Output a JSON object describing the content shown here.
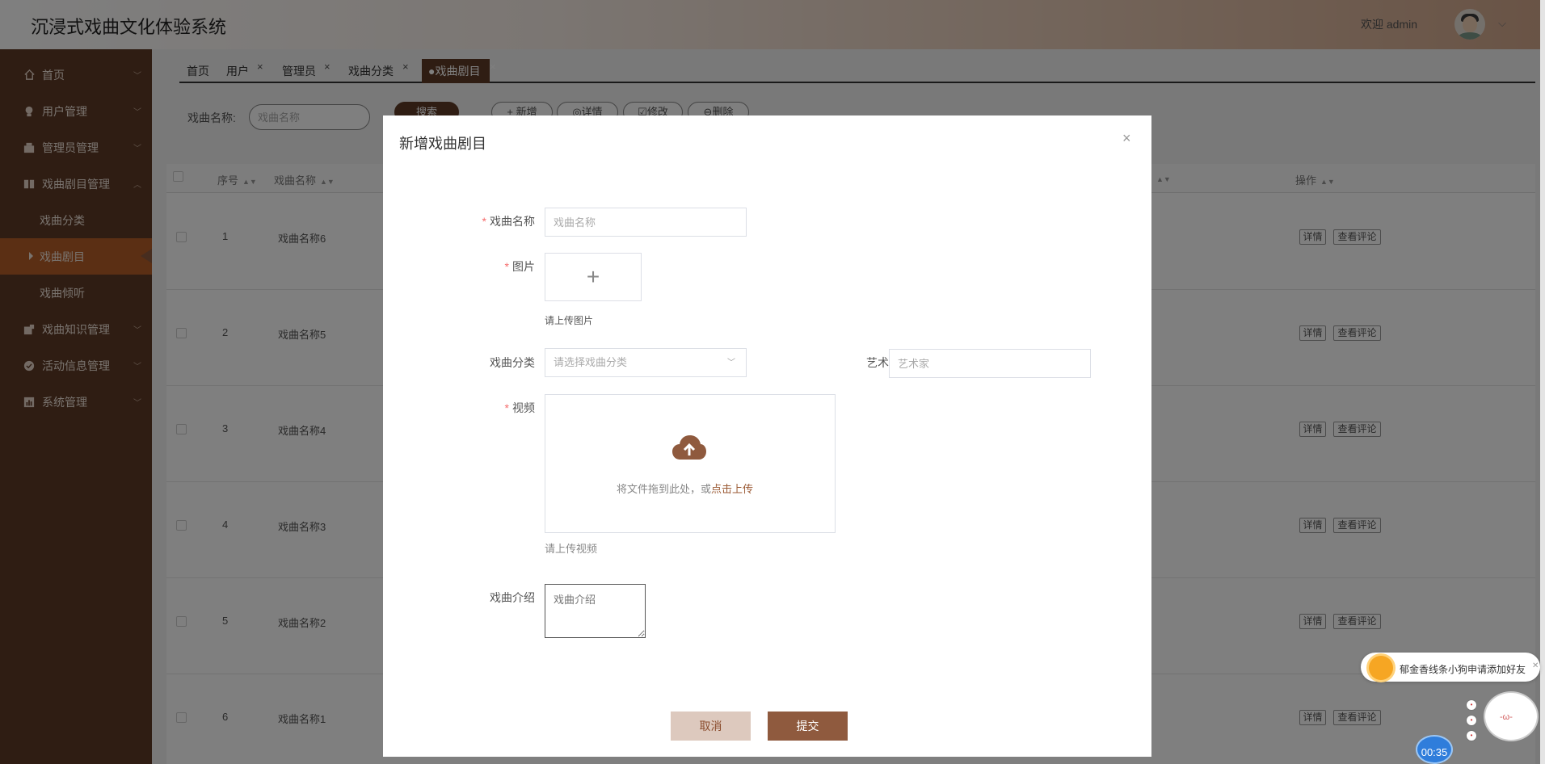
{
  "app": {
    "title": "沉浸式戏曲文化体验系统",
    "welcome": "欢迎 admin"
  },
  "sidebar": {
    "items": [
      {
        "label": "首页",
        "icon": "home-icon"
      },
      {
        "label": "用户管理",
        "icon": "user-icon"
      },
      {
        "label": "管理员管理",
        "icon": "admin-icon"
      },
      {
        "label": "戏曲剧目管理",
        "icon": "book-icon",
        "expanded": true,
        "children": [
          {
            "label": "戏曲分类"
          },
          {
            "label": "戏曲剧目",
            "active": true
          },
          {
            "label": "戏曲倾听"
          }
        ]
      },
      {
        "label": "戏曲知识管理",
        "icon": "knowledge-icon"
      },
      {
        "label": "活动信息管理",
        "icon": "check-circle-icon"
      },
      {
        "label": "系统管理",
        "icon": "chart-icon"
      }
    ]
  },
  "tabs": [
    {
      "label": "首页"
    },
    {
      "label": "用户"
    },
    {
      "label": "管理员"
    },
    {
      "label": "戏曲分类"
    },
    {
      "label": "●戏曲剧目",
      "active": true
    }
  ],
  "toolbar": {
    "search_label": "戏曲名称:",
    "search_placeholder": "戏曲名称",
    "search_button": "搜索",
    "add_button": "+ 新增",
    "detail_button": "◎详情",
    "edit_button": "☑修改",
    "delete_button": "⊖删除"
  },
  "table": {
    "headers": {
      "index": "序号",
      "name": "戏曲名称",
      "actions": "操作"
    },
    "rows": [
      {
        "index": "1",
        "name": "戏曲名称6"
      },
      {
        "index": "2",
        "name": "戏曲名称5"
      },
      {
        "index": "3",
        "name": "戏曲名称4"
      },
      {
        "index": "4",
        "name": "戏曲名称3"
      },
      {
        "index": "5",
        "name": "戏曲名称2"
      },
      {
        "index": "6",
        "name": "戏曲名称1"
      }
    ],
    "row_actions": {
      "detail": "详情",
      "comments": "查看评论"
    }
  },
  "dialog": {
    "title": "新增戏曲剧目",
    "close_glyph": "×",
    "required_mark": "*",
    "fields": {
      "name": {
        "label": "戏曲名称",
        "placeholder": "戏曲名称"
      },
      "image": {
        "label": "图片",
        "hint": "请上传图片"
      },
      "category": {
        "label": "戏曲分类",
        "placeholder": "请选择戏曲分类"
      },
      "artist": {
        "label": "艺术家",
        "placeholder": "艺术家"
      },
      "video": {
        "label": "视频",
        "drop_text": "将文件拖到此处，或",
        "drop_link": "点击上传",
        "hint": "请上传视频"
      },
      "intro": {
        "label": "戏曲介绍",
        "placeholder": "戏曲介绍"
      }
    },
    "cancel": "取消",
    "submit": "提交"
  },
  "widgets": {
    "notification": "郁金香线条小狗申请添加好友",
    "timer": "00:35",
    "mascot_face": "-ω-"
  },
  "colors": {
    "primary": "#5e3a26",
    "active_menu": "#b65e28",
    "submit": "#8f5a3e",
    "cancel_bg": "#ddc9be",
    "link": "#9b5a34",
    "required": "#f56c6c"
  }
}
